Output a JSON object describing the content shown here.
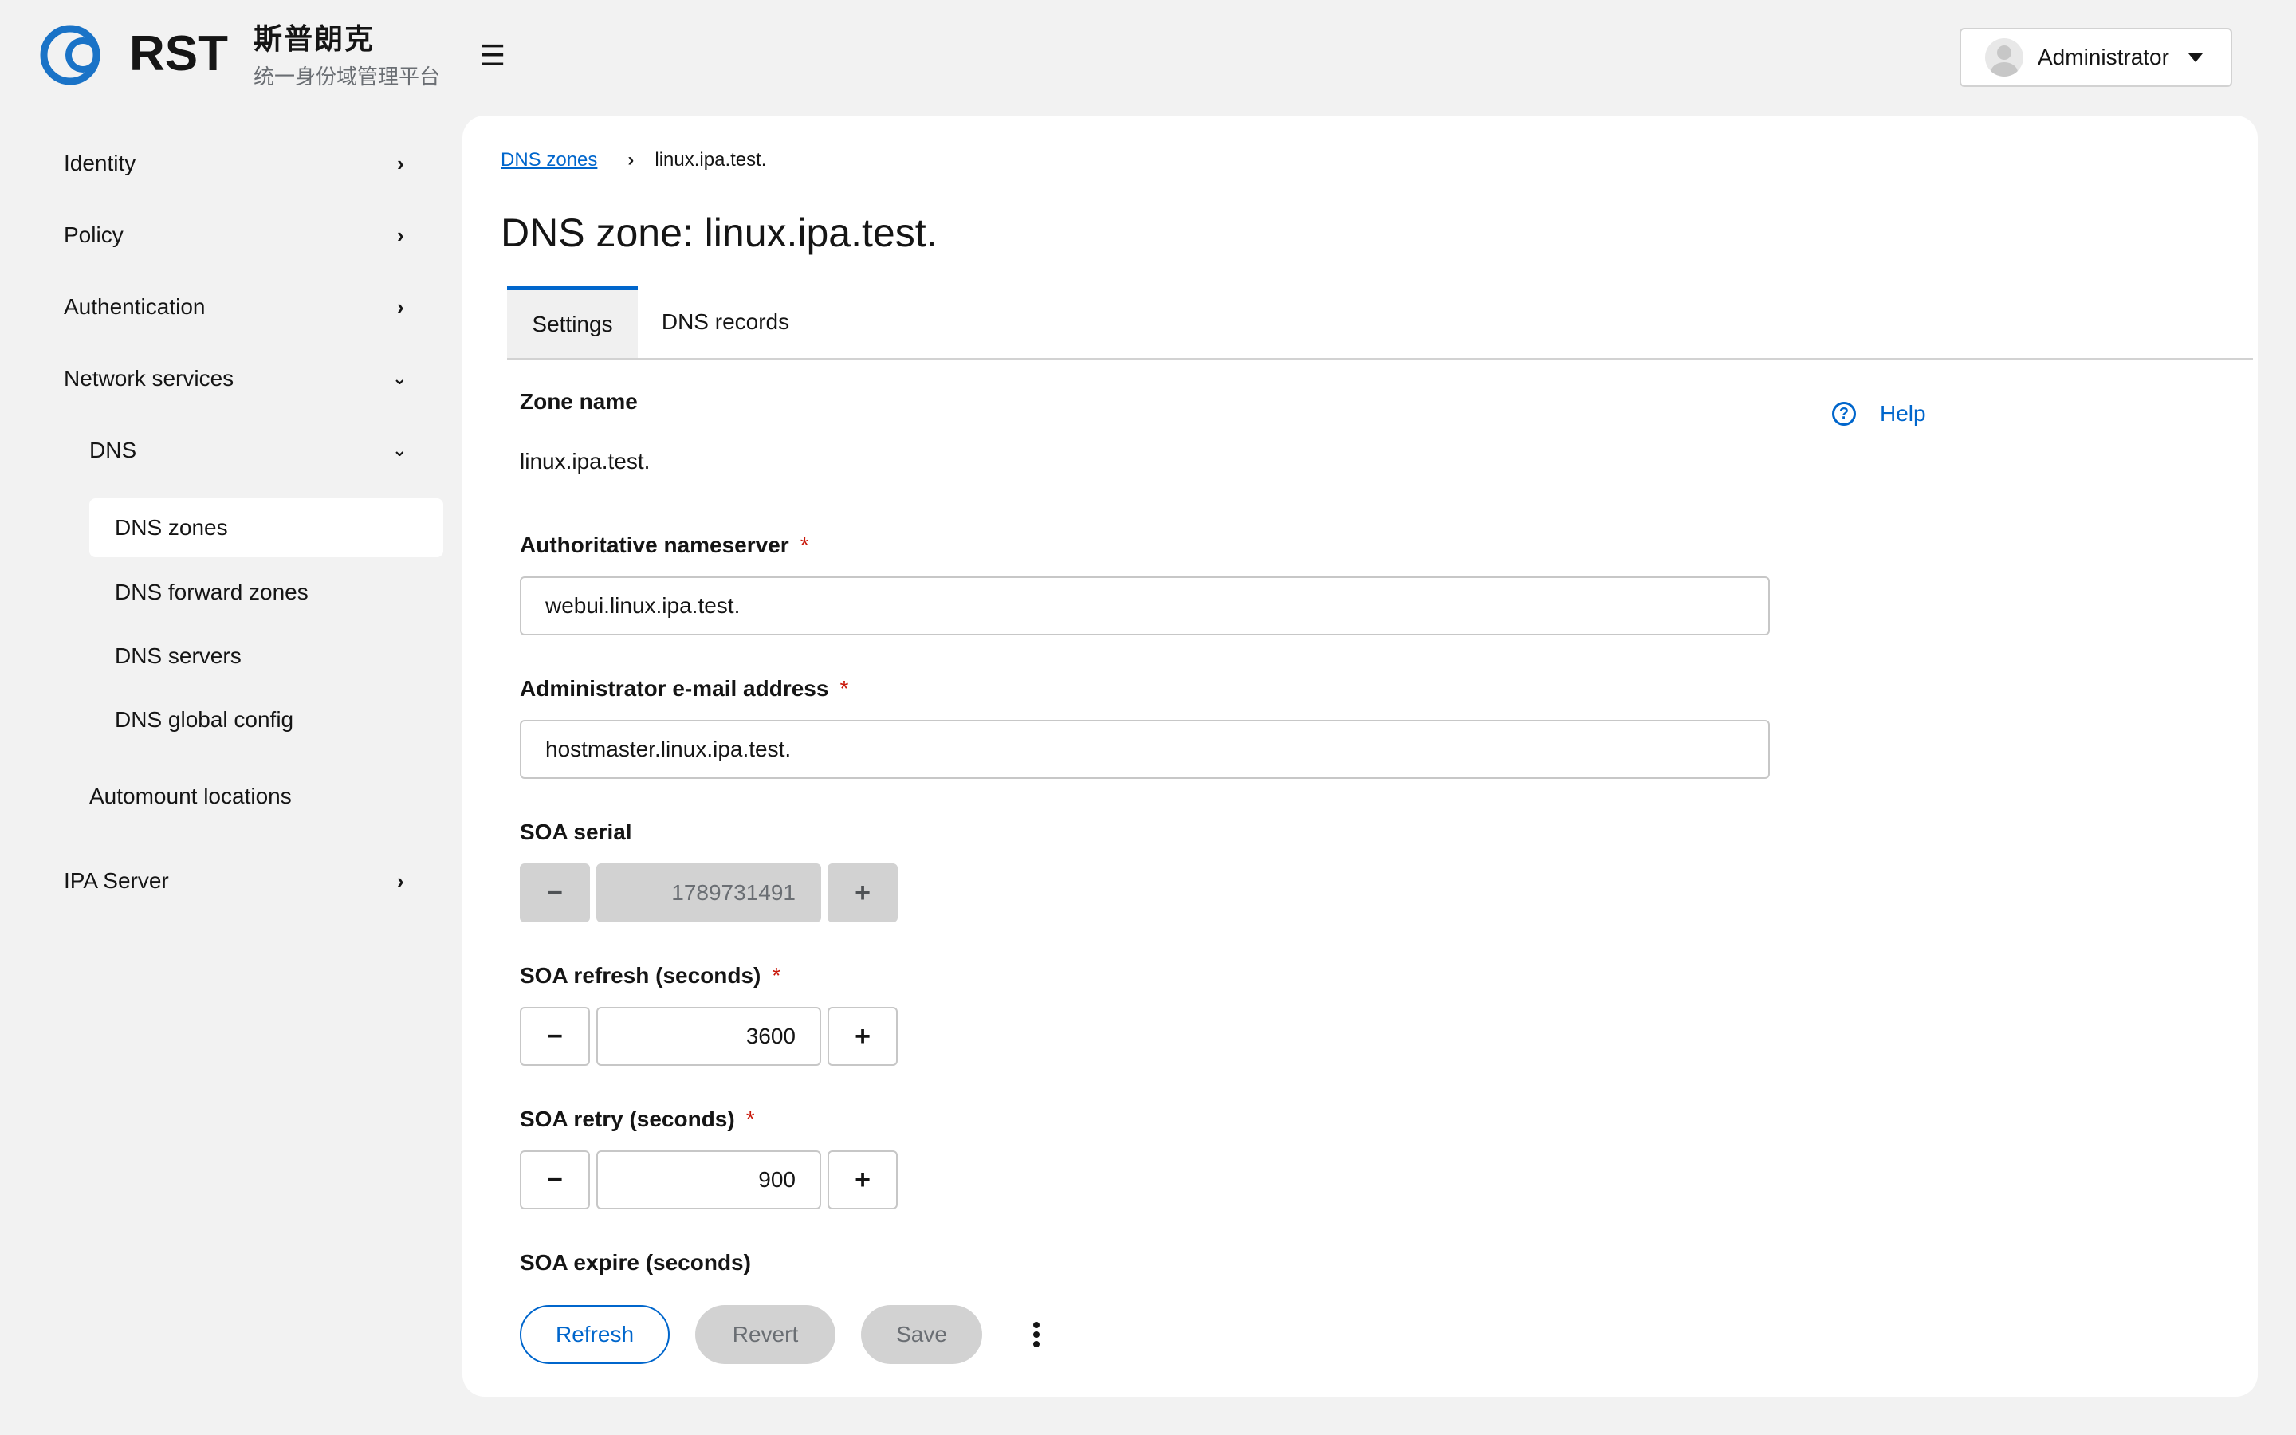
{
  "header": {
    "logo_text": "RST",
    "brand_cn": "斯普朗克",
    "brand_sub": "统一身份域管理平台",
    "menu_icon": "hamburger-icon",
    "user": {
      "name": "Administrator",
      "avatar_icon": "user-avatar-icon",
      "caret_icon": "caret-down-icon"
    }
  },
  "sidebar": {
    "items": [
      {
        "label": "Identity",
        "icon": "chevron-right-icon"
      },
      {
        "label": "Policy",
        "icon": "chevron-right-icon"
      },
      {
        "label": "Authentication",
        "icon": "chevron-right-icon"
      },
      {
        "label": "Network services",
        "icon": "chevron-down-icon"
      },
      {
        "label": "DNS",
        "icon": "chevron-down-icon"
      },
      {
        "label": "DNS zones",
        "active": true
      },
      {
        "label": "DNS forward zones"
      },
      {
        "label": "DNS servers"
      },
      {
        "label": "DNS global config"
      },
      {
        "label": "Automount locations"
      },
      {
        "label": "IPA Server",
        "icon": "chevron-right-icon"
      }
    ]
  },
  "breadcrumb": {
    "parent": "DNS zones",
    "separator_icon": "chevron-right-icon",
    "current": "linux.ipa.test."
  },
  "page_title": "DNS zone: linux.ipa.test.",
  "tabs": [
    {
      "label": "Settings",
      "active": true
    },
    {
      "label": "DNS records",
      "active": false
    }
  ],
  "help": {
    "label": "Help",
    "icon": "help-circle-icon"
  },
  "form": {
    "zone_name": {
      "label": "Zone name",
      "value": "linux.ipa.test."
    },
    "authoritative_ns": {
      "label": "Authoritative nameserver",
      "required_mark": "*",
      "value": "webui.linux.ipa.test."
    },
    "admin_email": {
      "label": "Administrator e-mail address",
      "required_mark": "*",
      "value": "hostmaster.linux.ipa.test."
    },
    "soa_serial": {
      "label": "SOA serial",
      "value": "1789731491",
      "disabled": true
    },
    "soa_refresh": {
      "label": "SOA refresh (seconds)",
      "required_mark": "*",
      "value": "3600"
    },
    "soa_retry": {
      "label": "SOA retry (seconds)",
      "required_mark": "*",
      "value": "900"
    },
    "soa_expire": {
      "label": "SOA expire (seconds)"
    },
    "minus_symbol": "−",
    "plus_symbol": "+"
  },
  "actions": {
    "refresh": "Refresh",
    "revert": "Revert",
    "save": "Save",
    "more_icon": "kebab-menu-icon"
  },
  "colors": {
    "accent": "#0066cc",
    "required": "#c9190b",
    "disabled_bg": "#d2d2d2",
    "page_bg": "#f2f2f2"
  }
}
